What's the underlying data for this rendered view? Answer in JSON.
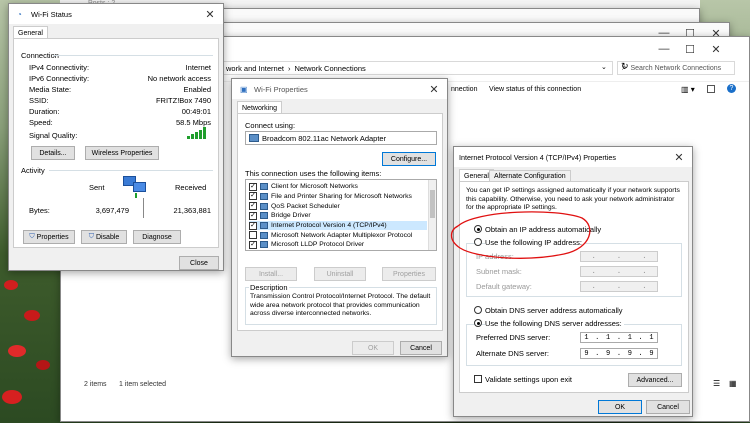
{
  "background": {
    "forum_posts": "Posts : 2"
  },
  "explorer": {
    "breadcrumb_partial": "work and Internet",
    "breadcrumb_sep": "›",
    "breadcrumb_current": "Network Connections",
    "search_placeholder": "Search Network Connections",
    "cmd_connection": "nnection",
    "cmd_status": "View status of this connection",
    "status_items": "2 items",
    "status_selected": "1 item selected"
  },
  "wifi_status": {
    "title": "Wi-Fi Status",
    "tab": "General",
    "connection_heading": "Connection",
    "rows": [
      {
        "label": "IPv4 Connectivity:",
        "value": "Internet"
      },
      {
        "label": "IPv6 Connectivity:",
        "value": "No network access"
      },
      {
        "label": "Media State:",
        "value": "Enabled"
      },
      {
        "label": "SSID:",
        "value": "FRITZ!Box 7490"
      },
      {
        "label": "Duration:",
        "value": "00:49:01"
      },
      {
        "label": "Speed:",
        "value": "58.5 Mbps"
      }
    ],
    "signal_label": "Signal Quality:",
    "details_btn": "Details...",
    "wireless_btn": "Wireless Properties",
    "activity_heading": "Activity",
    "sent_label": "Sent",
    "received_label": "Received",
    "bytes_label": "Bytes:",
    "bytes_sent": "3,697,479",
    "bytes_received": "21,363,881",
    "properties_btn": "Properties",
    "disable_btn": "Disable",
    "diagnose_btn": "Diagnose",
    "close_btn": "Close"
  },
  "wifi_props": {
    "title": "Wi-Fi Properties",
    "tab": "Networking",
    "connect_using": "Connect using:",
    "adapter": "Broadcom 802.11ac Network Adapter",
    "configure_btn": "Configure...",
    "items_label": "This connection uses the following items:",
    "items": [
      {
        "label": "Client for Microsoft Networks",
        "checked": true
      },
      {
        "label": "File and Printer Sharing for Microsoft Networks",
        "checked": true
      },
      {
        "label": "QoS Packet Scheduler",
        "checked": true
      },
      {
        "label": "Bridge Driver",
        "checked": true
      },
      {
        "label": "Internet Protocol Version 4 (TCP/IPv4)",
        "checked": true
      },
      {
        "label": "Microsoft Network Adapter Multiplexor Protocol",
        "checked": false
      },
      {
        "label": "Microsoft LLDP Protocol Driver",
        "checked": true
      }
    ],
    "install_btn": "Install...",
    "uninstall_btn": "Uninstall",
    "properties_btn": "Properties",
    "description_heading": "Description",
    "description": "Transmission Control Protocol/Internet Protocol. The default wide area network protocol that provides communication across diverse interconnected networks.",
    "ok_btn": "OK",
    "cancel_btn": "Cancel"
  },
  "ipv4": {
    "title": "Internet Protocol Version 4 (TCP/IPv4) Properties",
    "tab_general": "General",
    "tab_alternate": "Alternate Configuration",
    "intro": "You can get IP settings assigned automatically if your network supports this capability. Otherwise, you need to ask your network administrator for the appropriate IP settings.",
    "obtain_ip_auto": "Obtain an IP address automatically",
    "use_following_ip": "Use the following IP address:",
    "ip_address_label": "IP address:",
    "subnet_label": "Subnet mask:",
    "gateway_label": "Default gateway:",
    "obtain_dns_auto": "Obtain DNS server address automatically",
    "use_following_dns": "Use the following DNS server addresses:",
    "preferred_dns_label": "Preferred DNS server:",
    "alternate_dns_label": "Alternate DNS server:",
    "preferred_dns": [
      "1",
      "1",
      "1",
      "1"
    ],
    "alternate_dns": [
      "9",
      "9",
      "9",
      "9"
    ],
    "validate_label": "Validate settings upon exit",
    "advanced_btn": "Advanced...",
    "ok_btn": "OK",
    "cancel_btn": "Cancel"
  },
  "colors": {
    "annotation_red": "#e01010",
    "accent": "#0078d7"
  }
}
